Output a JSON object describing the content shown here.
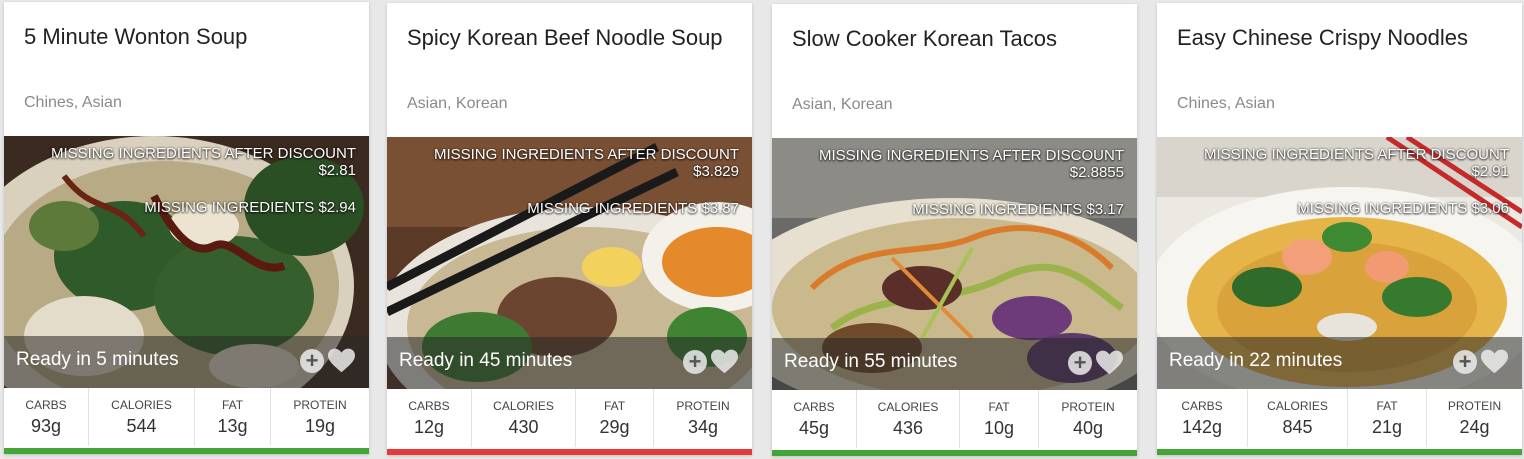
{
  "labels": {
    "after_discount": "MISSING INGREDIENTS AFTER DISCOUNT",
    "missing": "MISSING INGREDIENTS",
    "carbs": "CARBS",
    "calories": "CALORIES",
    "fat": "FAT",
    "protein": "PROTEIN"
  },
  "recipes": [
    {
      "title": "5 Minute Wonton Soup",
      "cuisines": "Chines, Asian",
      "discount_price": "$2.81",
      "missing_price": "$2.94",
      "ready": "Ready in 5 minutes",
      "carbs": "93g",
      "calories": "544",
      "fat": "13g",
      "protein": "19g",
      "status_color": "#43a537"
    },
    {
      "title": "Spicy Korean Beef Noodle Soup",
      "cuisines": "Asian, Korean",
      "discount_price": "$3.829",
      "missing_price": "$3.87",
      "ready": "Ready in 45 minutes",
      "carbs": "12g",
      "calories": "430",
      "fat": "29g",
      "protein": "34g",
      "status_color": "#e53a3a"
    },
    {
      "title": "Slow Cooker Korean Tacos",
      "cuisines": "Asian, Korean",
      "discount_price": "$2.8855",
      "missing_price": "$3.17",
      "ready": "Ready in 55 minutes",
      "carbs": "45g",
      "calories": "436",
      "fat": "10g",
      "protein": "40g",
      "status_color": "#43a537"
    },
    {
      "title": "Easy Chinese Crispy Noodles",
      "cuisines": "Chines, Asian",
      "discount_price": "$2.91",
      "missing_price": "$3.06",
      "ready": "Ready in 22 minutes",
      "carbs": "142g",
      "calories": "845",
      "fat": "21g",
      "protein": "24g",
      "status_color": "#43a537"
    }
  ],
  "icons": {
    "add": "plus-circle-icon",
    "favorite": "heart-icon"
  }
}
